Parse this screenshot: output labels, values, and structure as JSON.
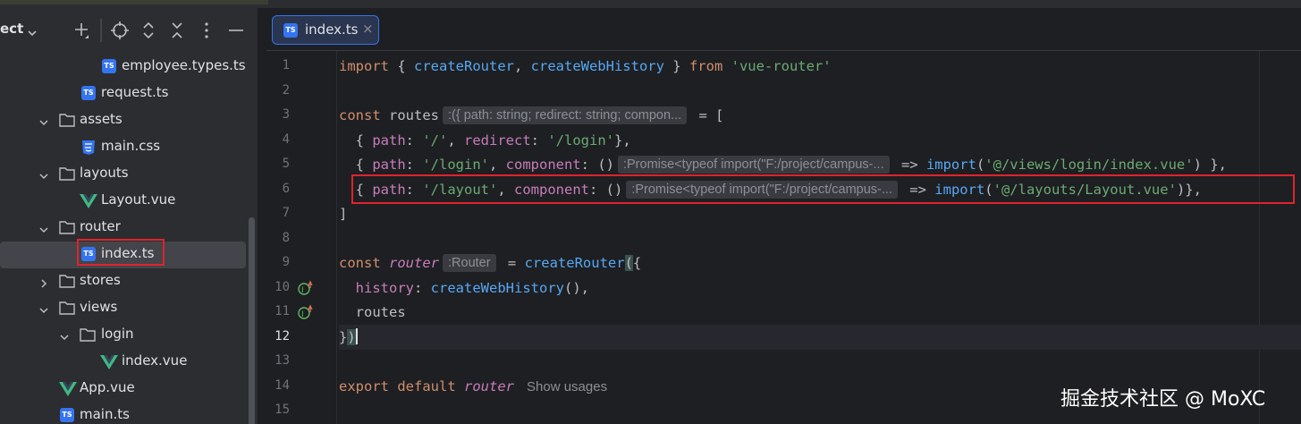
{
  "project_panel": {
    "title": "ect",
    "toolbar": [
      "add-icon",
      "locate-icon",
      "expand-all-icon",
      "collapse-all-icon",
      "more-icon",
      "hide-icon"
    ]
  },
  "tree": [
    {
      "label": "employee.types.ts",
      "type": "ts"
    },
    {
      "label": "request.ts",
      "type": "ts"
    },
    {
      "label": "assets",
      "type": "folder",
      "expanded": true
    },
    {
      "label": "main.css",
      "type": "css"
    },
    {
      "label": "layouts",
      "type": "folder",
      "expanded": true
    },
    {
      "label": "Layout.vue",
      "type": "vue"
    },
    {
      "label": "router",
      "type": "folder",
      "expanded": true
    },
    {
      "label": "index.ts",
      "type": "ts",
      "selected": true
    },
    {
      "label": "stores",
      "type": "folder",
      "expanded": false
    },
    {
      "label": "views",
      "type": "folder",
      "expanded": true
    },
    {
      "label": "login",
      "type": "folder",
      "expanded": true
    },
    {
      "label": "index.vue",
      "type": "vue"
    },
    {
      "label": "App.vue",
      "type": "vue"
    },
    {
      "label": "main.ts",
      "type": "ts"
    }
  ],
  "editor": {
    "tab_label": "index.ts",
    "tab_close": "×",
    "line_numbers": [
      "1",
      "2",
      "3",
      "4",
      "5",
      "6",
      "7",
      "8",
      "9",
      "10",
      "11",
      "12",
      "13",
      "14",
      "15"
    ],
    "current_line": "12",
    "hints": {
      "routes_type": ":({ path: string; redirect: string; compon...",
      "promise_login": ":Promise<typeof import(\"F:/project/campus-...",
      "promise_layout": ":Promise<typeof import(\"F:/project/campus-...",
      "router_type": ":Router"
    },
    "code": {
      "import_kw": "import",
      "import_names_1": "createRouter",
      "import_names_2": "createWebHistory",
      "from_kw": "from",
      "module": "'vue-router'",
      "const_kw": "const",
      "routes_var": "routes",
      "path_key": "path",
      "redirect_key": "redirect",
      "component_key": "component",
      "root_path": "'/'",
      "login_path": "'/login'",
      "layout_path": "'/layout'",
      "import_call": "import",
      "login_view": "'@/views/login/index.vue'",
      "layout_view": "'@/layouts/Layout.vue'",
      "router_var": "router",
      "create_router": "createRouter",
      "history_key": "history",
      "create_web_history": "createWebHistory",
      "export_kw": "export",
      "default_kw": "default",
      "show_usages": "Show usages"
    }
  },
  "watermark": "掘金技术社区 @ MoXC",
  "colors": {
    "keyword": "#cf8e6d",
    "function": "#56a8f5",
    "string": "#6aab73",
    "property": "#c77dbb",
    "highlight_box": "#e0232c",
    "selection": "#43454a"
  }
}
